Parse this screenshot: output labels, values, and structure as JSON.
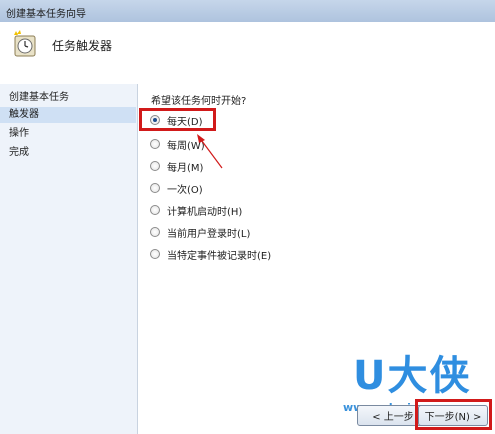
{
  "window": {
    "title": "创建基本任务向导"
  },
  "header": {
    "title": "任务触发器",
    "icon": "clock-task-icon"
  },
  "sidebar": {
    "items": [
      {
        "label": "创建基本任务",
        "active": false
      },
      {
        "label": "触发器",
        "active": true
      },
      {
        "label": "操作",
        "active": false
      },
      {
        "label": "完成",
        "active": false
      }
    ]
  },
  "main": {
    "prompt": "希望该任务何时开始?",
    "options": [
      {
        "label": "每天(D)",
        "selected": true
      },
      {
        "label": "每周(W)",
        "selected": false
      },
      {
        "label": "每月(M)",
        "selected": false
      },
      {
        "label": "一次(O)",
        "selected": false
      },
      {
        "label": "计算机启动时(H)",
        "selected": false
      },
      {
        "label": "当前用户登录时(L)",
        "selected": false
      },
      {
        "label": "当特定事件被记录时(E)",
        "selected": false
      }
    ]
  },
  "buttons": {
    "back": "< 上一步",
    "next": "下一步(N) >"
  },
  "watermark": {
    "brand": "U大侠",
    "url": "www.udaxia.com"
  },
  "colors": {
    "highlight": "#d11a1a",
    "watermark": "#2f8ee0",
    "selected_bg": "#cfe0f4"
  }
}
